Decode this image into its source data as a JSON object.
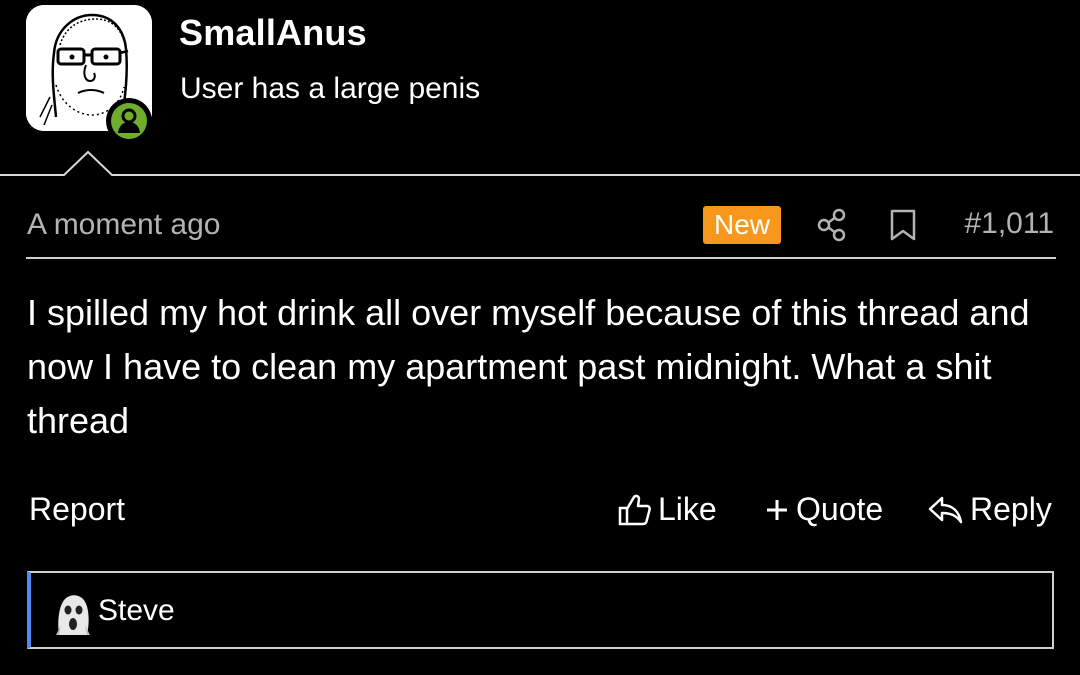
{
  "user": {
    "name": "SmallAnus",
    "title": "User has a large penis",
    "online_color": "#6fae2c"
  },
  "post": {
    "timestamp": "A moment ago",
    "badge": "New",
    "number": "#1,011",
    "body": "I spilled my hot drink all over myself because of this thread and now I have to clean my apartment past midnight. What a shit thread"
  },
  "actions": {
    "report": "Report",
    "like": "Like",
    "quote": "Quote",
    "reply": "Reply"
  },
  "reply_box": {
    "name": "Steve"
  },
  "icons": [
    "share-icon",
    "bookmark-icon",
    "thumbs-up-icon",
    "plus-icon",
    "reply-arrow-icon",
    "user-online-icon"
  ],
  "colors": {
    "background": "#000000",
    "new_badge": "#f7981c",
    "reply_accent": "#4f8cf0"
  }
}
